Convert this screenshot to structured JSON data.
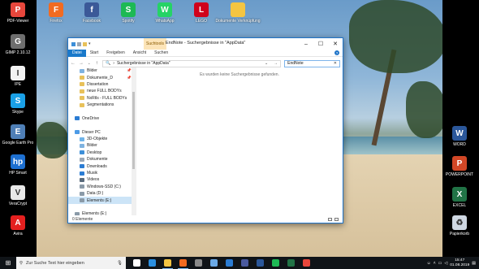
{
  "desktop": {
    "left_icons": [
      {
        "label": "PDF-Viewer",
        "icon": "pdf-viewer-icon",
        "color": "#e8473c",
        "glyph": "P"
      },
      {
        "label": "GIMP 2.10.12",
        "icon": "gimp-icon",
        "color": "#6e6e6e",
        "glyph": "G"
      },
      {
        "label": "IPE",
        "icon": "ipe-icon",
        "color": "#f2f2f2",
        "glyph": "I"
      },
      {
        "label": "Skype",
        "icon": "skype-icon",
        "color": "#1aa0e6",
        "glyph": "S"
      },
      {
        "label": "Google Earth Pro",
        "icon": "google-earth-icon",
        "color": "#4f7fb6",
        "glyph": "E"
      },
      {
        "label": "HP Smart",
        "icon": "hp-smart-icon",
        "color": "#1d6fd0",
        "glyph": "hp"
      },
      {
        "label": "VeraCrypt",
        "icon": "veracrypt-icon",
        "color": "#e8e8e8",
        "glyph": "V"
      },
      {
        "label": "Avira",
        "icon": "avira-icon",
        "color": "#e4201f",
        "glyph": "A"
      }
    ],
    "top_icons": [
      {
        "label": "Firefox",
        "icon": "firefox-icon",
        "color": "#f26b21",
        "glyph": "F"
      },
      {
        "label": "Facebook",
        "icon": "facebook-icon",
        "color": "#3b5998",
        "glyph": "f"
      },
      {
        "label": "Spotify",
        "icon": "spotify-icon",
        "color": "#1db954",
        "glyph": "S"
      },
      {
        "label": "WhatsApp",
        "icon": "whatsapp-icon",
        "color": "#25d366",
        "glyph": "W"
      },
      {
        "label": "LEGO",
        "icon": "lego-figure-icon",
        "color": "#d0021b",
        "glyph": "L"
      },
      {
        "label": "Dokumente Verknüpfung",
        "icon": "folder-shortcut-icon",
        "color": "#f4c542",
        "glyph": ""
      }
    ],
    "right_icons": [
      {
        "label": "WORD",
        "icon": "word-icon",
        "color": "#2b579a",
        "glyph": "W"
      },
      {
        "label": "POWERPOINT",
        "icon": "powerpoint-icon",
        "color": "#d24726",
        "glyph": "P"
      },
      {
        "label": "EXCEL",
        "icon": "excel-icon",
        "color": "#217346",
        "glyph": "X"
      },
      {
        "label": "Papierkorb",
        "icon": "recycle-bin-icon",
        "color": "#cfd8e3",
        "glyph": "♻"
      }
    ]
  },
  "window": {
    "contextual_tab": "Suchtools",
    "title": "EndNote - Suchergebnisse in \"AppData\"",
    "controls": {
      "minimize": "–",
      "maximize": "☐",
      "close": "✕"
    },
    "ribbon_tabs": [
      "Datei",
      "Start",
      "Freigeben",
      "Ansicht",
      "Suchen"
    ],
    "address": "Suchergebnisse in \"AppData\"",
    "search_value": "EndNote",
    "nav_items": [
      {
        "label": "Bilder",
        "icon": "pictures-icon",
        "color": "#7fb3e0",
        "pinned": true,
        "indent": 1
      },
      {
        "label": "Dokumente_D",
        "icon": "folder-icon",
        "color": "#e8c15a",
        "pinned": true,
        "indent": 1
      },
      {
        "label": "Dissertation",
        "icon": "folder-icon",
        "color": "#e8c15a",
        "pinned": false,
        "indent": 1
      },
      {
        "label": "neue FULL BODYs",
        "icon": "folder-icon",
        "color": "#e8c15a",
        "pinned": false,
        "indent": 1
      },
      {
        "label": "NxRtls - FULL BODYs",
        "icon": "folder-icon",
        "color": "#e8c15a",
        "pinned": false,
        "indent": 1
      },
      {
        "label": "Segmentations",
        "icon": "folder-icon",
        "color": "#e8c15a",
        "pinned": false,
        "indent": 1
      },
      {
        "label": "",
        "icon": "",
        "color": "",
        "pinned": false,
        "indent": 0
      },
      {
        "label": "OneDrive",
        "icon": "onedrive-icon",
        "color": "#2b7cd3",
        "pinned": false,
        "indent": 0
      },
      {
        "label": "",
        "icon": "",
        "color": "",
        "pinned": false,
        "indent": 0
      },
      {
        "label": "Dieser PC",
        "icon": "this-pc-icon",
        "color": "#4d9be6",
        "pinned": false,
        "indent": 0
      },
      {
        "label": "3D-Objekte",
        "icon": "3d-objects-icon",
        "color": "#6fb3e8",
        "pinned": false,
        "indent": 1
      },
      {
        "label": "Bilder",
        "icon": "pictures-icon",
        "color": "#7fb3e0",
        "pinned": false,
        "indent": 1
      },
      {
        "label": "Desktop",
        "icon": "desktop-icon",
        "color": "#3d8fd8",
        "pinned": false,
        "indent": 1
      },
      {
        "label": "Dokumente",
        "icon": "documents-icon",
        "color": "#9aa7b5",
        "pinned": false,
        "indent": 1
      },
      {
        "label": "Downloads",
        "icon": "downloads-icon",
        "color": "#2b7cd3",
        "pinned": false,
        "indent": 1
      },
      {
        "label": "Musik",
        "icon": "music-icon",
        "color": "#2b7cd3",
        "pinned": false,
        "indent": 1
      },
      {
        "label": "Videos",
        "icon": "videos-icon",
        "color": "#5a6b7c",
        "pinned": false,
        "indent": 1
      },
      {
        "label": "Windows-SSD (C:)",
        "icon": "drive-c-icon",
        "color": "#8a9aa8",
        "pinned": false,
        "indent": 1
      },
      {
        "label": "Data (D:)",
        "icon": "drive-icon",
        "color": "#8a9aa8",
        "pinned": false,
        "indent": 1
      },
      {
        "label": "Elements (E:)",
        "icon": "drive-icon",
        "color": "#8a9aa8",
        "pinned": false,
        "indent": 1,
        "selected": true
      },
      {
        "label": "",
        "icon": "",
        "color": "",
        "pinned": false,
        "indent": 0
      },
      {
        "label": "Elements (E:)",
        "icon": "drive-icon",
        "color": "#8a9aa8",
        "pinned": false,
        "indent": 0
      }
    ],
    "empty_message": "Es wurden keine Suchergebnisse gefunden.",
    "status": "0 Elemente"
  },
  "taskbar": {
    "search_placeholder": "Zur Suche Text hier eingeben",
    "apps": [
      {
        "icon": "task-view-icon",
        "color": "#ffffff",
        "active": false
      },
      {
        "icon": "edge-icon",
        "color": "#2b8fe0",
        "active": false
      },
      {
        "icon": "file-explorer-icon",
        "color": "#f4c542",
        "active": true
      },
      {
        "icon": "firefox-icon",
        "color": "#f26b21",
        "active": true
      },
      {
        "icon": "gimp-icon",
        "color": "#8a8a8a",
        "active": false
      },
      {
        "icon": "photos-icon",
        "color": "#6aa9e6",
        "active": false
      },
      {
        "icon": "mail-icon",
        "color": "#2b7cd3",
        "active": false
      },
      {
        "icon": "endnote-icon",
        "color": "#4a5a9e",
        "active": false
      },
      {
        "icon": "word-icon",
        "color": "#2b579a",
        "active": false
      },
      {
        "icon": "spotify-icon",
        "color": "#1db954",
        "active": false
      },
      {
        "icon": "excel-icon",
        "color": "#217346",
        "active": false
      },
      {
        "icon": "pdf-icon",
        "color": "#e8473c",
        "active": false
      }
    ],
    "time": "15:47",
    "date": "01.08.2019"
  }
}
